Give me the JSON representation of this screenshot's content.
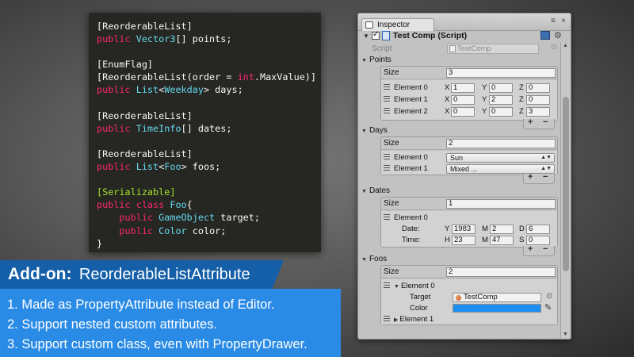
{
  "code": {
    "lines": [
      [
        [
          "plain",
          "[ReorderableList]"
        ]
      ],
      [
        [
          "kw",
          "public "
        ],
        [
          "type",
          "Vector3"
        ],
        [
          "plain",
          "[] points;"
        ]
      ],
      [],
      [
        [
          "plain",
          "[EnumFlag]"
        ]
      ],
      [
        [
          "plain",
          "[ReorderableList(order = "
        ],
        [
          "kw",
          "int"
        ],
        [
          "plain",
          ".MaxValue)]"
        ]
      ],
      [
        [
          "kw",
          "public "
        ],
        [
          "type",
          "List"
        ],
        [
          "plain",
          "<"
        ],
        [
          "type",
          "Weekday"
        ],
        [
          "plain",
          "> days;"
        ]
      ],
      [],
      [
        [
          "plain",
          "[ReorderableList]"
        ]
      ],
      [
        [
          "kw",
          "public "
        ],
        [
          "type",
          "TimeInfo"
        ],
        [
          "plain",
          "[] dates;"
        ]
      ],
      [],
      [
        [
          "plain",
          "[ReorderableList]"
        ]
      ],
      [
        [
          "kw",
          "public "
        ],
        [
          "type",
          "List"
        ],
        [
          "plain",
          "<"
        ],
        [
          "type",
          "Foo"
        ],
        [
          "plain",
          "> foos;"
        ]
      ],
      [],
      [
        [
          "attr",
          "[Serializable]"
        ]
      ],
      [
        [
          "kw",
          "public class "
        ],
        [
          "type",
          "Foo"
        ],
        [
          "plain",
          "{"
        ]
      ],
      [
        [
          "plain",
          "    "
        ],
        [
          "kw",
          "public "
        ],
        [
          "type",
          "GameObject"
        ],
        [
          "plain",
          " target;"
        ]
      ],
      [
        [
          "plain",
          "    "
        ],
        [
          "kw",
          "public "
        ],
        [
          "type",
          "Color"
        ],
        [
          "plain",
          " color;"
        ]
      ],
      [
        [
          "plain",
          "}"
        ]
      ]
    ],
    "colors": {
      "plain": "#f8f8f2",
      "kw": "#f92672",
      "type": "#66d9ef",
      "attr": "#a6e22e"
    }
  },
  "addon": {
    "heading": "Add-on:",
    "name": "ReorderableListAttribute",
    "items": [
      "1. Made as PropertyAttribute instead of Editor.",
      "2. Support nested custom attributes.",
      "3. Support custom class, even with PropertyDrawer."
    ]
  },
  "inspector": {
    "tab_label": "Inspector",
    "menu_glyph": "≡",
    "close_glyph": "×",
    "component": {
      "title": "Test Comp (Script)"
    },
    "script": {
      "label": "Script",
      "value": "TestComp"
    },
    "points": {
      "label": "Points",
      "size_label": "Size",
      "size": "3",
      "elements": [
        {
          "label": "Element 0",
          "x": "1",
          "y": "0",
          "z": "0"
        },
        {
          "label": "Element 1",
          "x": "0",
          "y": "2",
          "z": "0"
        },
        {
          "label": "Element 2",
          "x": "0",
          "y": "0",
          "z": "3"
        }
      ],
      "axes": {
        "x": "X",
        "y": "Y",
        "z": "Z"
      }
    },
    "days": {
      "label": "Days",
      "size_label": "Size",
      "size": "2",
      "elements": [
        {
          "label": "Element 0",
          "value": "Sun"
        },
        {
          "label": "Element 1",
          "value": "Mixed ..."
        }
      ]
    },
    "dates": {
      "label": "Dates",
      "size_label": "Size",
      "size": "1",
      "element_label": "Element 0",
      "date_label": "Date:",
      "time_label": "Time:",
      "y_label": "Y",
      "m_label": "M",
      "d_label": "D",
      "h_label": "H",
      "min_label": "M",
      "s_label": "S",
      "year": "1983",
      "month": "2",
      "day": "6",
      "hour": "23",
      "minute": "47",
      "second": "0"
    },
    "foos": {
      "label": "Foos",
      "size_label": "Size",
      "size": "2",
      "element0_label": "Element 0",
      "target_label": "Target",
      "target_value": "TestComp",
      "color_label": "Color",
      "color_value": "#1e8ef0",
      "element1_label": "Element 1"
    },
    "footer": {
      "plus": "+",
      "minus": "−"
    }
  }
}
